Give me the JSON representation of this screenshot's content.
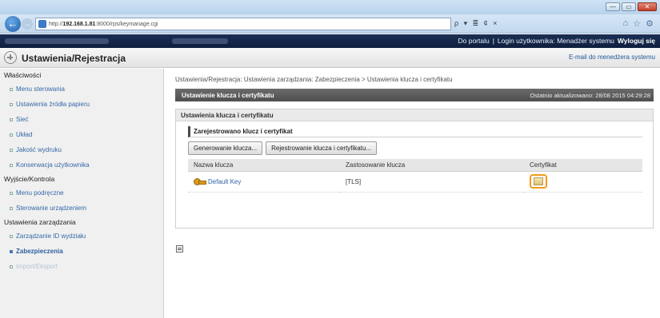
{
  "browser": {
    "url_prefix": "http://",
    "url_host": "192.168.1.81",
    "url_rest": ":8000/rps/keymanage.cgi",
    "addr_tools": "ρ ▾ ≣ ¢ ×",
    "window_controls": [
      "—",
      "▭",
      "✕"
    ]
  },
  "portal": {
    "links": [
      "Do portalu",
      "Login użytkownika: Menadżer systemu",
      "Wyloguj się"
    ]
  },
  "header": {
    "title": "Ustawienia/Rejestracja",
    "email_link": "E-mail do menedżera systemu"
  },
  "sidebar": {
    "groups": [
      {
        "title": "Właściwości",
        "items": [
          "Menu sterowania",
          "Ustawienia źródła papieru",
          "Sieć",
          "Układ",
          "Jakość wydruku",
          "Konserwacja użytkownika"
        ]
      },
      {
        "title": "Wyjście/Kontrola",
        "items": [
          "Menu podręczne",
          "Sterowanie urządzeniem"
        ]
      },
      {
        "title": "Ustawienia zarządzania",
        "items": [
          "Zarządzanie ID wydziału",
          "Zabezpieczenia",
          "Import/Eksport"
        ]
      }
    ]
  },
  "main": {
    "breadcrumb": "Ustawienia/Rejestracja: Ustawienia zarządzania: Zabezpieczenia > Ustawienia klucza i certyfikatu",
    "section_title": "Ustawienie klucza i certyfikatu",
    "last_updated": "Ostatnio aktualizowano: 28/08 2015 04:29:28",
    "panel_title": "Ustawienia klucza i certyfikatu",
    "registered_title": "Zarejestrowano klucz i certyfikat",
    "buttons": [
      "Generowanie klucza...",
      "Rejestrowanie klucza i certyfikatu..."
    ],
    "columns": [
      "Nazwa klucza",
      "Zastosowanie klucza",
      "Certyfikat"
    ],
    "rows": [
      {
        "key_name": "Default Key",
        "usage": "[TLS]"
      }
    ]
  }
}
